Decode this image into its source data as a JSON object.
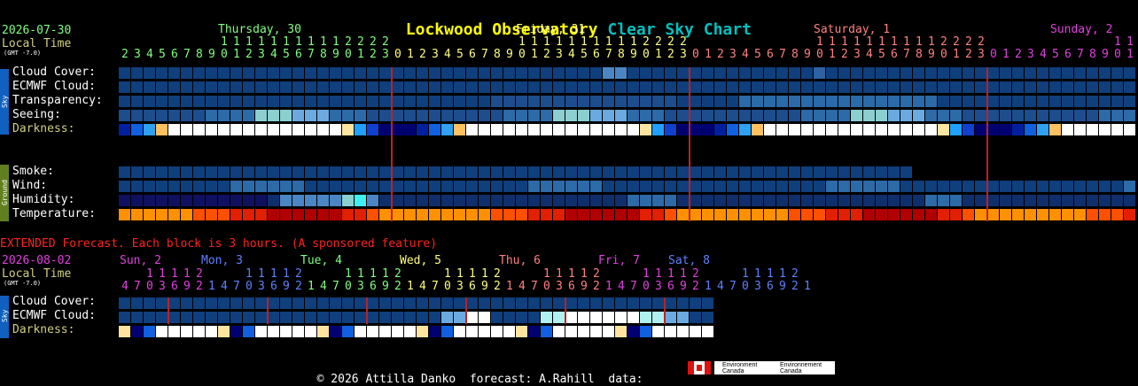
{
  "title": {
    "part1": "Lockwood Observatory",
    "part2": "Clear Sky Chart"
  },
  "main": {
    "date": "2026-07-30",
    "local_time": "Local Time",
    "gmt": "(GMT -7.0)",
    "days": [
      {
        "label": "Thursday, 30",
        "color": "#80ff80"
      },
      {
        "label": "Friday, 31",
        "color": "#ffff80"
      },
      {
        "label": "Saturday, 1",
        "color": "#ff8080"
      },
      {
        "label": "Sunday, 2",
        "color": "#e040e0"
      }
    ],
    "hours": [
      2,
      3,
      4,
      5,
      6,
      7,
      8,
      9,
      10,
      11,
      12,
      13,
      14,
      15,
      16,
      17,
      18,
      19,
      20,
      21,
      22,
      23,
      0,
      1,
      2,
      3,
      4,
      5,
      6,
      7,
      8,
      9,
      10,
      11,
      12,
      13,
      14,
      15,
      16,
      17,
      18,
      19,
      20,
      21,
      22,
      23,
      0,
      1,
      2,
      3,
      4,
      5,
      6,
      7,
      8,
      9,
      10,
      11,
      12,
      13,
      14,
      15,
      16,
      17,
      18,
      19,
      20,
      21,
      22,
      23,
      0,
      1,
      2,
      3,
      4,
      5,
      6,
      7,
      8,
      9,
      10,
      11
    ],
    "sky_label": "Sky",
    "ground_label": "Ground",
    "rows": [
      {
        "label": "Cloud Cover:"
      },
      {
        "label": "ECMWF Cloud:"
      },
      {
        "label": "Transparency:"
      },
      {
        "label": "Seeing:"
      },
      {
        "label": "Darkness:"
      },
      {
        "label": "Smoke:"
      },
      {
        "label": "Wind:"
      },
      {
        "label": "Humidity:"
      },
      {
        "label": "Temperature:"
      }
    ]
  },
  "extended": {
    "notice": "EXTENDED Forecast. Each block is 3 hours. (A sponsored feature)",
    "date": "2026-08-02",
    "local_time": "Local Time",
    "gmt": "(GMT -7.0)",
    "days": [
      {
        "label": "Sun, 2",
        "color": "#e040e0"
      },
      {
        "label": "Mon, 3",
        "color": "#6080ff"
      },
      {
        "label": "Tue, 4",
        "color": "#80ff80"
      },
      {
        "label": "Wed, 5",
        "color": "#ffff80"
      },
      {
        "label": "Thu, 6",
        "color": "#ff8080"
      },
      {
        "label": "Fri, 7",
        "color": "#e040e0"
      },
      {
        "label": "Sat, 8",
        "color": "#6080ff"
      }
    ],
    "hours": [
      4,
      7,
      10,
      13,
      16,
      19,
      22,
      1,
      4,
      7,
      10,
      13,
      16,
      19,
      22,
      1,
      4,
      7,
      10,
      13,
      16,
      19,
      22,
      1,
      4,
      7,
      10,
      13,
      16,
      19,
      22,
      1,
      4,
      7,
      10,
      13,
      16,
      19,
      22,
      1,
      4,
      7,
      10,
      13,
      16,
      19,
      22,
      1,
      4,
      7,
      10,
      13,
      16,
      19,
      22,
      1
    ],
    "sky_label": "Sky",
    "rows": [
      {
        "label": "Cloud Cover:"
      },
      {
        "label": "ECMWF Cloud:"
      },
      {
        "label": "Darkness:"
      }
    ]
  },
  "footer": {
    "text": "© 2026 Attilla Danko  forecast: A.Rahill  data:",
    "logo_text1": "Environment Canada",
    "logo_text2": "Environnement Canada"
  },
  "colors": {
    "title1": "#ffff00",
    "title2": "#00c0c0",
    "date": "#80ff80",
    "local": "#d0d080",
    "label": "#ffffff",
    "darkness_label": "#d0d080",
    "notice": "#ff2020",
    "cursor": "#c02020"
  }
}
